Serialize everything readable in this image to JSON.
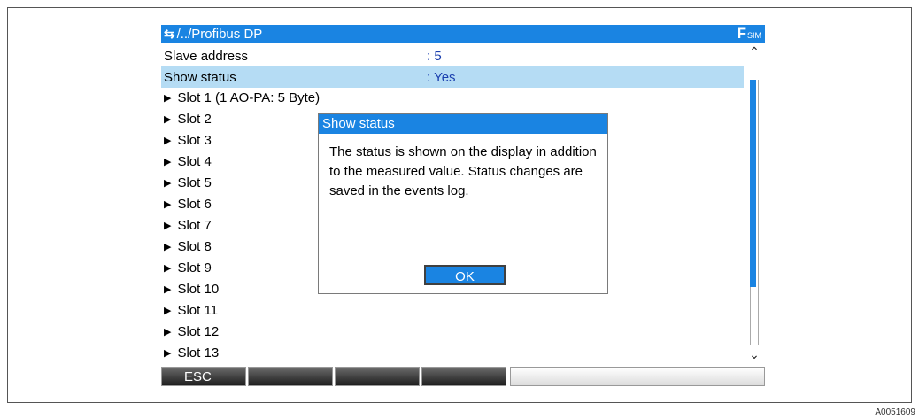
{
  "header": {
    "nav_icon": "⇆",
    "path": "/../Profibus DP",
    "mode_letter": "F",
    "mode_sub": "SIM"
  },
  "params": [
    {
      "label": "Slave address",
      "value": ": 5",
      "selected": false
    },
    {
      "label": "Show status",
      "value": ": Yes",
      "selected": true
    }
  ],
  "slots": [
    "Slot 1 (1 AO-PA: 5 Byte)",
    "Slot 2",
    "Slot 3",
    "Slot 4",
    "Slot 5",
    "Slot 6",
    "Slot 7",
    "Slot 8",
    "Slot 9",
    "Slot 10",
    "Slot 11",
    "Slot 12",
    "Slot 13"
  ],
  "dialog": {
    "title": "Show status",
    "text": "The status is shown on the display in addition to the measured value. Status changes are saved in the events log.",
    "ok_label": "OK"
  },
  "softkeys": [
    "ESC",
    "",
    "",
    ""
  ],
  "scroll": {
    "up_icon": "chevron-up-icon",
    "down_icon": "chevron-down-icon",
    "thumb_fraction": 0.78
  },
  "figure_id": "A0051609",
  "colors": {
    "accent": "#1a84e2",
    "selection": "#b5dcf4",
    "value": "#1a3fae"
  }
}
